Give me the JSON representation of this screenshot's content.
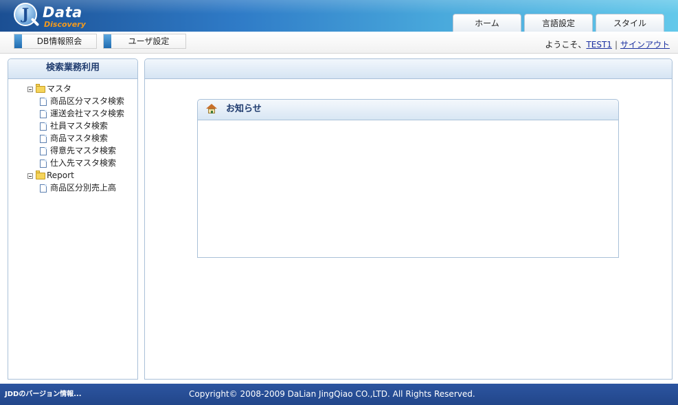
{
  "header": {
    "logo_data": "Data",
    "logo_discovery": "Discovery",
    "logo_j": "J",
    "tabs": [
      {
        "label": "ホーム"
      },
      {
        "label": "言語設定"
      },
      {
        "label": "スタイル"
      }
    ]
  },
  "toolbar": {
    "menu": [
      {
        "label": "DB情報照会"
      },
      {
        "label": "ユーザ設定"
      }
    ],
    "welcome_prefix": "ようこそ、",
    "user": "TEST1",
    "separator": "|",
    "signout": "サインアウト"
  },
  "sidebar": {
    "title": "検索業務利用",
    "tree": [
      {
        "label": "マスタ",
        "items": [
          {
            "label": "商品区分マスタ検索"
          },
          {
            "label": "運送会社マスタ検索"
          },
          {
            "label": "社員マスタ検索"
          },
          {
            "label": "商品マスタ検索"
          },
          {
            "label": "得意先マスタ検索"
          },
          {
            "label": "仕入先マスタ検索"
          }
        ]
      },
      {
        "label": "Report",
        "items": [
          {
            "label": "商品区分別売上高"
          }
        ]
      }
    ]
  },
  "main": {
    "notice_title": "お知らせ"
  },
  "footer": {
    "version_link": "JDDのバージョン情報...",
    "copyright": "Copyright© 2008-2009 DaLian JingQiao CO.,LTD. All Rights Reserved."
  },
  "colors": {
    "header_start": "#1b4f93",
    "header_end": "#63c8ea",
    "footer_bg": "#22468a",
    "panel_border": "#a9c0d8",
    "link": "#1a2fa0"
  }
}
